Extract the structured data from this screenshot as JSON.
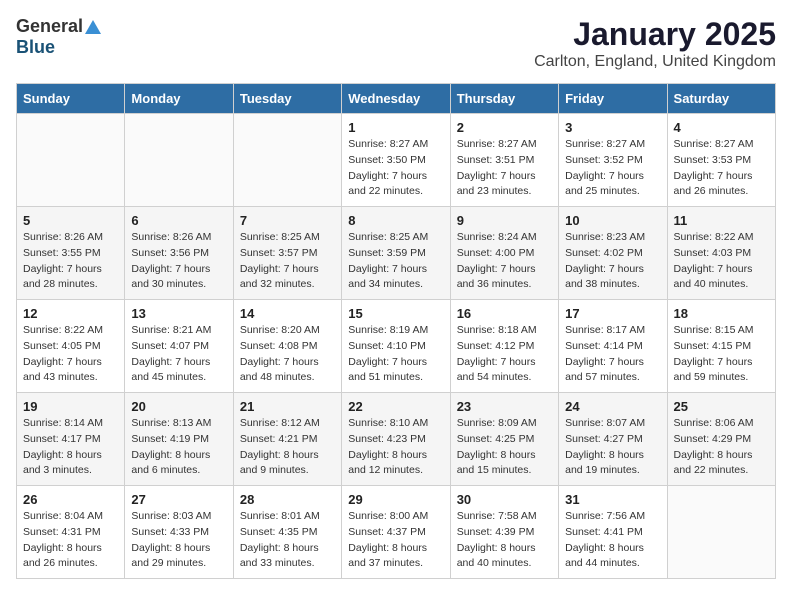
{
  "logo": {
    "general": "General",
    "blue": "Blue"
  },
  "title": "January 2025",
  "subtitle": "Carlton, England, United Kingdom",
  "headers": [
    "Sunday",
    "Monday",
    "Tuesday",
    "Wednesday",
    "Thursday",
    "Friday",
    "Saturday"
  ],
  "weeks": [
    [
      {
        "num": "",
        "info": ""
      },
      {
        "num": "",
        "info": ""
      },
      {
        "num": "",
        "info": ""
      },
      {
        "num": "1",
        "info": "Sunrise: 8:27 AM\nSunset: 3:50 PM\nDaylight: 7 hours\nand 22 minutes."
      },
      {
        "num": "2",
        "info": "Sunrise: 8:27 AM\nSunset: 3:51 PM\nDaylight: 7 hours\nand 23 minutes."
      },
      {
        "num": "3",
        "info": "Sunrise: 8:27 AM\nSunset: 3:52 PM\nDaylight: 7 hours\nand 25 minutes."
      },
      {
        "num": "4",
        "info": "Sunrise: 8:27 AM\nSunset: 3:53 PM\nDaylight: 7 hours\nand 26 minutes."
      }
    ],
    [
      {
        "num": "5",
        "info": "Sunrise: 8:26 AM\nSunset: 3:55 PM\nDaylight: 7 hours\nand 28 minutes."
      },
      {
        "num": "6",
        "info": "Sunrise: 8:26 AM\nSunset: 3:56 PM\nDaylight: 7 hours\nand 30 minutes."
      },
      {
        "num": "7",
        "info": "Sunrise: 8:25 AM\nSunset: 3:57 PM\nDaylight: 7 hours\nand 32 minutes."
      },
      {
        "num": "8",
        "info": "Sunrise: 8:25 AM\nSunset: 3:59 PM\nDaylight: 7 hours\nand 34 minutes."
      },
      {
        "num": "9",
        "info": "Sunrise: 8:24 AM\nSunset: 4:00 PM\nDaylight: 7 hours\nand 36 minutes."
      },
      {
        "num": "10",
        "info": "Sunrise: 8:23 AM\nSunset: 4:02 PM\nDaylight: 7 hours\nand 38 minutes."
      },
      {
        "num": "11",
        "info": "Sunrise: 8:22 AM\nSunset: 4:03 PM\nDaylight: 7 hours\nand 40 minutes."
      }
    ],
    [
      {
        "num": "12",
        "info": "Sunrise: 8:22 AM\nSunset: 4:05 PM\nDaylight: 7 hours\nand 43 minutes."
      },
      {
        "num": "13",
        "info": "Sunrise: 8:21 AM\nSunset: 4:07 PM\nDaylight: 7 hours\nand 45 minutes."
      },
      {
        "num": "14",
        "info": "Sunrise: 8:20 AM\nSunset: 4:08 PM\nDaylight: 7 hours\nand 48 minutes."
      },
      {
        "num": "15",
        "info": "Sunrise: 8:19 AM\nSunset: 4:10 PM\nDaylight: 7 hours\nand 51 minutes."
      },
      {
        "num": "16",
        "info": "Sunrise: 8:18 AM\nSunset: 4:12 PM\nDaylight: 7 hours\nand 54 minutes."
      },
      {
        "num": "17",
        "info": "Sunrise: 8:17 AM\nSunset: 4:14 PM\nDaylight: 7 hours\nand 57 minutes."
      },
      {
        "num": "18",
        "info": "Sunrise: 8:15 AM\nSunset: 4:15 PM\nDaylight: 7 hours\nand 59 minutes."
      }
    ],
    [
      {
        "num": "19",
        "info": "Sunrise: 8:14 AM\nSunset: 4:17 PM\nDaylight: 8 hours\nand 3 minutes."
      },
      {
        "num": "20",
        "info": "Sunrise: 8:13 AM\nSunset: 4:19 PM\nDaylight: 8 hours\nand 6 minutes."
      },
      {
        "num": "21",
        "info": "Sunrise: 8:12 AM\nSunset: 4:21 PM\nDaylight: 8 hours\nand 9 minutes."
      },
      {
        "num": "22",
        "info": "Sunrise: 8:10 AM\nSunset: 4:23 PM\nDaylight: 8 hours\nand 12 minutes."
      },
      {
        "num": "23",
        "info": "Sunrise: 8:09 AM\nSunset: 4:25 PM\nDaylight: 8 hours\nand 15 minutes."
      },
      {
        "num": "24",
        "info": "Sunrise: 8:07 AM\nSunset: 4:27 PM\nDaylight: 8 hours\nand 19 minutes."
      },
      {
        "num": "25",
        "info": "Sunrise: 8:06 AM\nSunset: 4:29 PM\nDaylight: 8 hours\nand 22 minutes."
      }
    ],
    [
      {
        "num": "26",
        "info": "Sunrise: 8:04 AM\nSunset: 4:31 PM\nDaylight: 8 hours\nand 26 minutes."
      },
      {
        "num": "27",
        "info": "Sunrise: 8:03 AM\nSunset: 4:33 PM\nDaylight: 8 hours\nand 29 minutes."
      },
      {
        "num": "28",
        "info": "Sunrise: 8:01 AM\nSunset: 4:35 PM\nDaylight: 8 hours\nand 33 minutes."
      },
      {
        "num": "29",
        "info": "Sunrise: 8:00 AM\nSunset: 4:37 PM\nDaylight: 8 hours\nand 37 minutes."
      },
      {
        "num": "30",
        "info": "Sunrise: 7:58 AM\nSunset: 4:39 PM\nDaylight: 8 hours\nand 40 minutes."
      },
      {
        "num": "31",
        "info": "Sunrise: 7:56 AM\nSunset: 4:41 PM\nDaylight: 8 hours\nand 44 minutes."
      },
      {
        "num": "",
        "info": ""
      }
    ]
  ]
}
